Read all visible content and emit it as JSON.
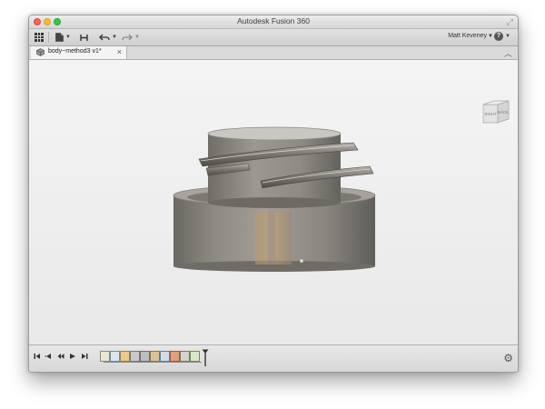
{
  "window": {
    "title": "Autodesk Fusion 360"
  },
  "toolbar": {
    "user_name": "Matt Keveney",
    "help_label": "?",
    "buttons": [
      "data-panel",
      "file",
      "save",
      "undo",
      "redo"
    ]
  },
  "tabs": [
    {
      "label": "body~method3 v1*",
      "active": true
    }
  ],
  "viewcube": {
    "faces": [
      "RIGHT",
      "BACK"
    ]
  },
  "timeline": {
    "playback_controls": [
      "go-to-start",
      "step-back",
      "play",
      "step-forward",
      "go-to-end"
    ],
    "feature_icons": [
      "sketch",
      "sketch",
      "extrude",
      "coil",
      "combine",
      "fillet",
      "sketch",
      "extrude",
      "thread",
      "sketch",
      "chamfer"
    ]
  },
  "colors": {
    "window_bg": "#efefef",
    "canvas_bg": "#f0f0f0",
    "model_body": "#8f8b84",
    "timeline_marker": "#333333"
  }
}
